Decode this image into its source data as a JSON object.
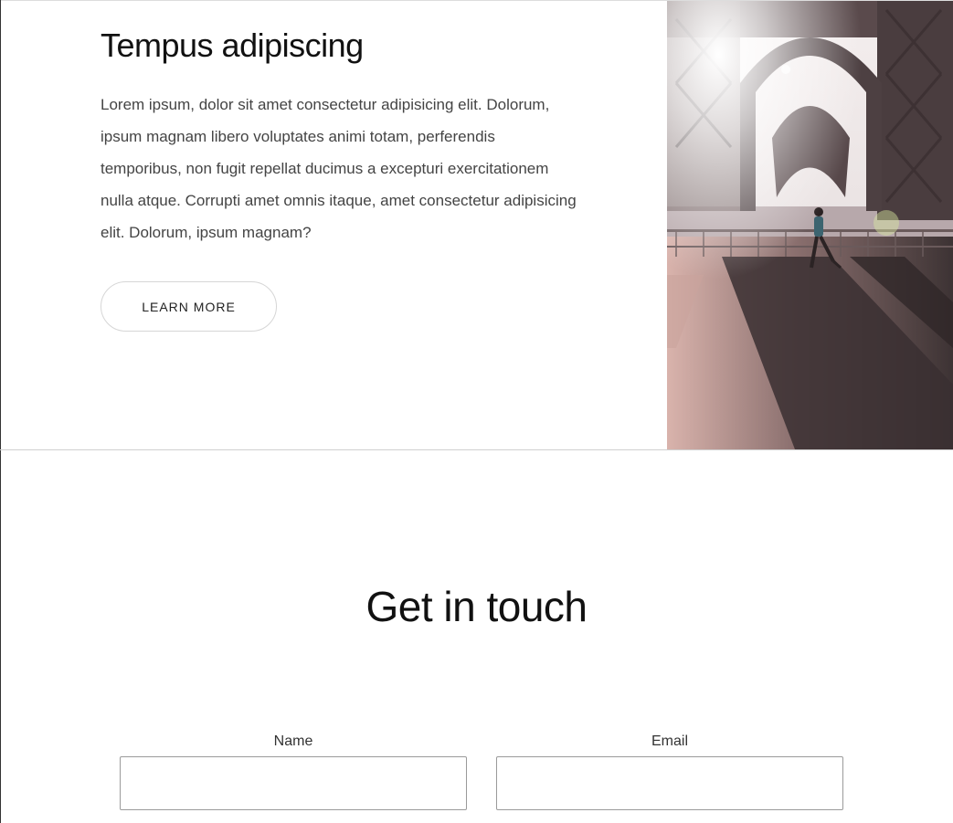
{
  "feature": {
    "title": "Tempus adipiscing",
    "body": "Lorem ipsum, dolor sit amet consectetur adipisicing elit. Dolorum, ipsum magnam libero voluptates animi totam, perferendis temporibus, non fugit repellat ducimus a excepturi exercitationem nulla atque. Corrupti amet omnis itaque, amet consectetur adipisicing elit. Dolorum, ipsum magnam?",
    "button_label": "LEARN MORE",
    "image_icon": "bridge-runner-photo"
  },
  "contact": {
    "title": "Get in touch",
    "name_label": "Name",
    "name_value": "",
    "email_label": "Email",
    "email_value": ""
  },
  "colors": {
    "text": "#111111",
    "border": "#9a9a9a",
    "button_border": "#d6d6d6"
  }
}
